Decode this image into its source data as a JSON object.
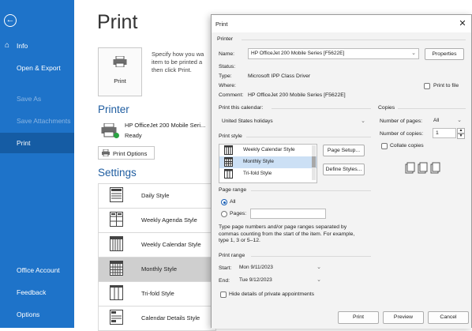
{
  "sidebar": {
    "back_icon": "back-arrow-icon",
    "items": [
      {
        "label": "Info",
        "icon": "home-icon"
      },
      {
        "label": "Open & Export"
      },
      {
        "label": "Save As"
      },
      {
        "label": "Save Attachments"
      },
      {
        "label": "Print"
      },
      {
        "label": "Office Account"
      },
      {
        "label": "Feedback"
      },
      {
        "label": "Options"
      }
    ],
    "active": "Print",
    "colors": {
      "background": "#1e73c9",
      "active": "#155ca4"
    }
  },
  "main": {
    "title": "Print",
    "print_button_label": "Print",
    "description": [
      "Specify how you wa",
      "item to be printed a",
      "then click Print."
    ],
    "printer_heading": "Printer",
    "printer_name": "HP OfficeJet 200 Mobile Seri...",
    "printer_status": "Ready",
    "print_options_label": "Print Options",
    "settings_heading": "Settings",
    "styles": [
      {
        "label": "Daily Style"
      },
      {
        "label": "Weekly Agenda Style"
      },
      {
        "label": "Weekly Calendar Style"
      },
      {
        "label": "Monthly Style"
      },
      {
        "label": "Tri-fold Style"
      },
      {
        "label": "Calendar Details Style"
      }
    ],
    "selected_style": "Monthly Style"
  },
  "dialog": {
    "title": "Print",
    "close_icon": "close-icon",
    "printer_group": "Printer",
    "name_label": "Name:",
    "name_value": "HP OfficeJet 200 Mobile Series [F5622E]",
    "properties_label": "Properties",
    "status_label": "Status:",
    "type_label": "Type:",
    "type_value": "Microsoft IPP Class Driver",
    "where_label": "Where:",
    "comment_label": "Comment:",
    "comment_value": "HP OfficeJet 200 Mobile Series [F5622E]",
    "print_to_file_label": "Print to file",
    "print_this_calendar_label": "Print this calendar:",
    "calendar_value": "United States holidays",
    "print_style_label": "Print style",
    "print_styles": [
      "Weekly Calendar Style",
      "Monthly Style",
      "Tri-fold Style"
    ],
    "selected_print_style": "Monthly Style",
    "page_setup_label": "Page Setup...",
    "define_styles_label": "Define Styles...",
    "copies_group": "Copies",
    "number_of_pages_label": "Number of pages:",
    "number_of_pages_value": "All",
    "number_of_copies_label": "Number of copies:",
    "number_of_copies_value": "1",
    "collate_label": "Collate copies",
    "page_range_group": "Page range",
    "all_label": "All",
    "pages_label": "Pages:",
    "page_range_help": [
      "Type page numbers and/or page ranges separated by",
      "commas counting from the start of the item. For example,",
      "type 1, 3 or 5–12."
    ],
    "print_range_group": "Print range",
    "start_label": "Start:",
    "start_value": "Mon 9/11/2023",
    "end_label": "End:",
    "end_value": "Tue 9/12/2023",
    "hide_details_label": "Hide details of private appointments",
    "print_btn": "Print",
    "preview_btn": "Preview",
    "cancel_btn": "Cancel"
  }
}
